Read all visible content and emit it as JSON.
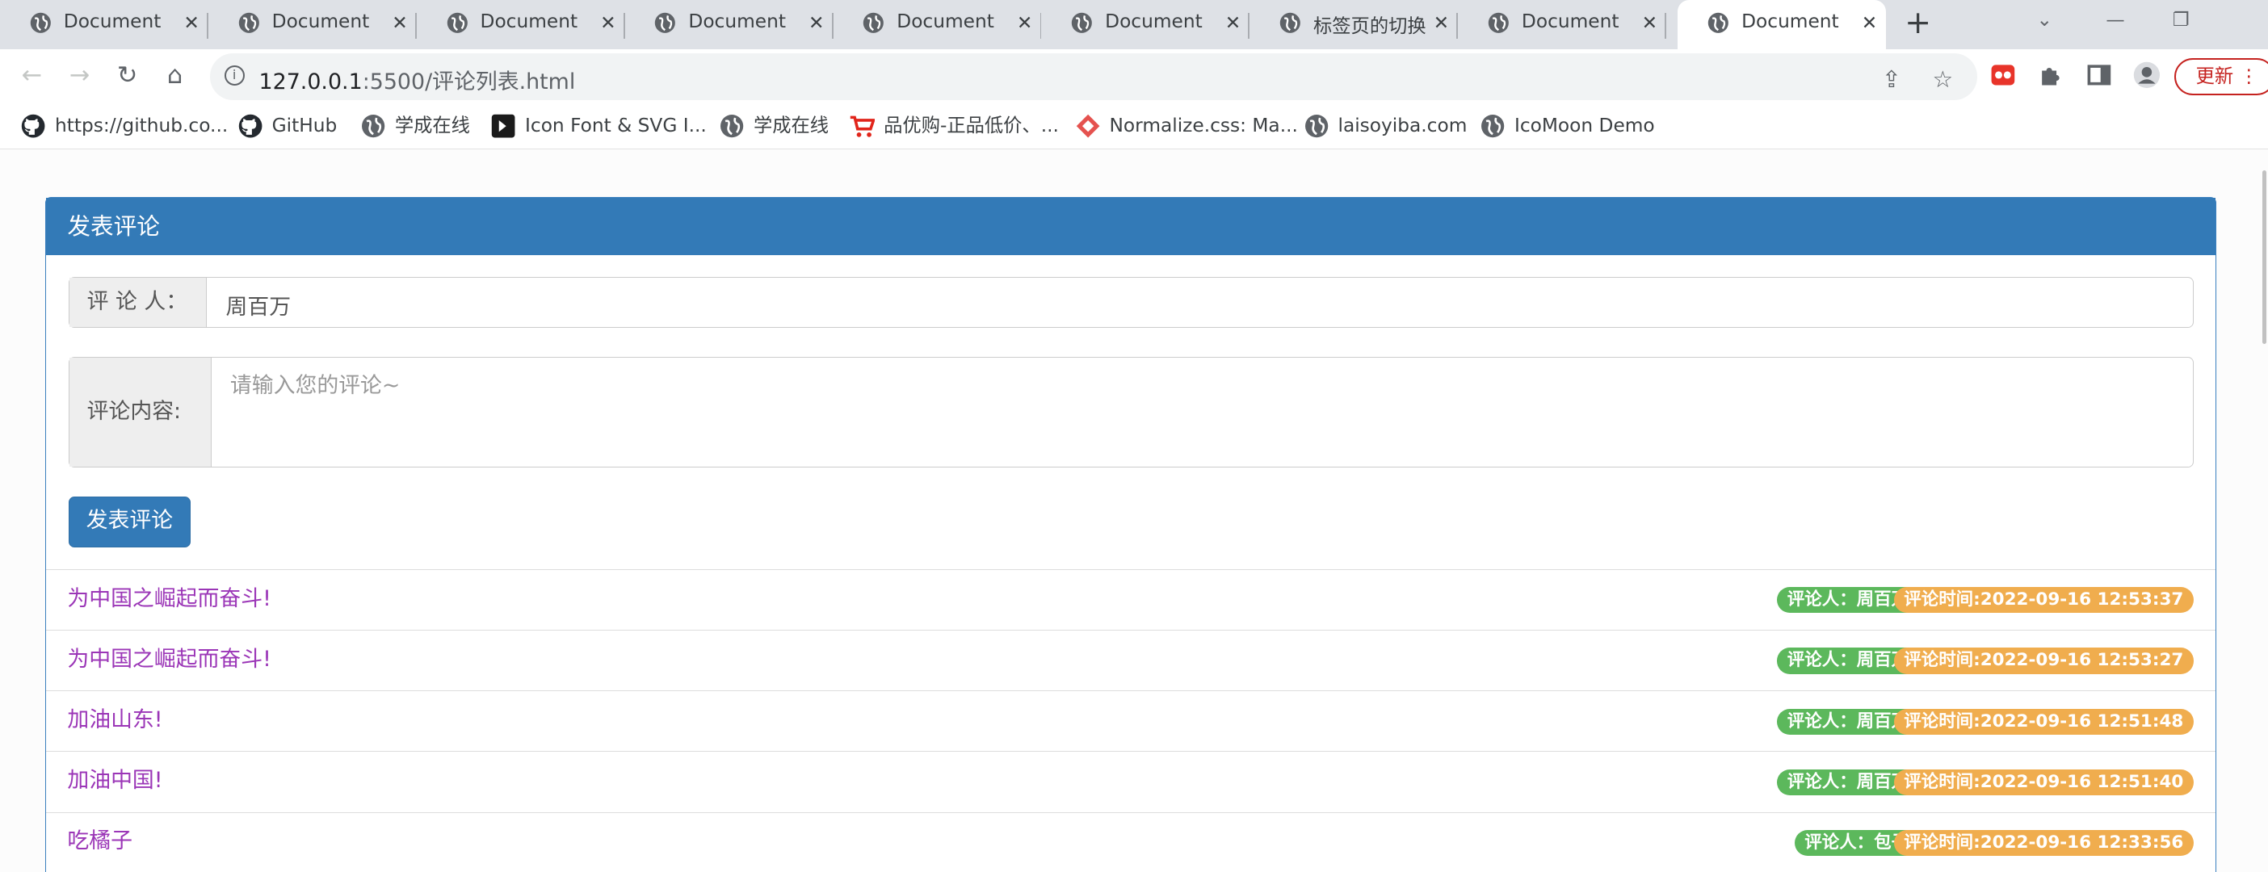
{
  "browser": {
    "tabs": [
      {
        "title": "Document",
        "active": false
      },
      {
        "title": "Document",
        "active": false
      },
      {
        "title": "Document",
        "active": false
      },
      {
        "title": "Document",
        "active": false
      },
      {
        "title": "Document",
        "active": false
      },
      {
        "title": "Document",
        "active": false
      },
      {
        "title": "标签页的切换",
        "active": false
      },
      {
        "title": "Document",
        "active": false
      },
      {
        "title": "Document",
        "active": true
      }
    ],
    "url_host": "127.0.0.1",
    "url_path": ":5500/评论列表.html",
    "update_label": "更新",
    "bookmarks": [
      {
        "label": "https://github.co...",
        "icon": "github-icon"
      },
      {
        "label": "GitHub",
        "icon": "github-icon"
      },
      {
        "label": "学成在线",
        "icon": "globe-icon"
      },
      {
        "label": "Icon Font & SVG I...",
        "icon": "iconfont-icon"
      },
      {
        "label": "学成在线",
        "icon": "globe-icon"
      },
      {
        "label": "品优购-正品低价、...",
        "icon": "cart-icon"
      },
      {
        "label": "Normalize.css: Ma...",
        "icon": "normalize-icon"
      },
      {
        "label": "laisoyiba.com",
        "icon": "globe-icon"
      },
      {
        "label": "IcoMoon Demo",
        "icon": "globe-icon"
      }
    ]
  },
  "page": {
    "panel_title": "发表评论",
    "commenter_label": "评 论 人：",
    "commenter_value": "周百万",
    "content_label": "评论内容:",
    "content_placeholder": "请输入您的评论~",
    "submit_label": "发表评论",
    "comments": [
      {
        "text": "为中国之崛起而奋斗!",
        "user": "评论人：周百万",
        "time": "评论时间:2022-09-16 12:53:37"
      },
      {
        "text": "为中国之崛起而奋斗!",
        "user": "评论人：周百万",
        "time": "评论时间:2022-09-16 12:53:27"
      },
      {
        "text": "加油山东!",
        "user": "评论人：周百万",
        "time": "评论时间:2022-09-16 12:51:48"
      },
      {
        "text": "加油中国!",
        "user": "评论人：周百万",
        "time": "评论时间:2022-09-16 12:51:40"
      },
      {
        "text": "吃橘子",
        "user": "评论人：包子",
        "time": "评论时间:2022-09-16 12:33:56"
      }
    ]
  },
  "colors": {
    "primary": "#337ab7",
    "comment_text": "#9b36b7",
    "badge_user": "#5cb85c",
    "badge_time": "#f0ad4e",
    "update_red": "#c5221f"
  }
}
